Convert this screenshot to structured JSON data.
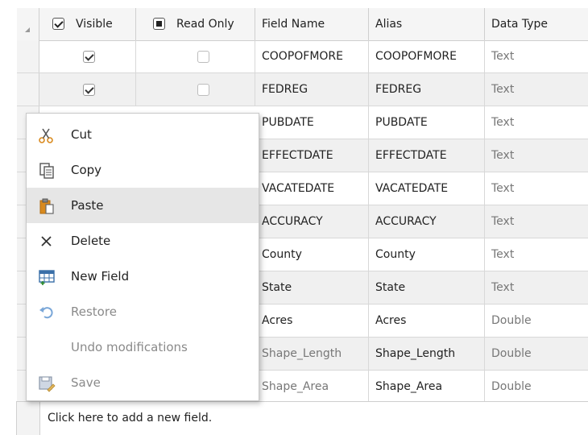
{
  "header": {
    "visible_label": "Visible",
    "read_only_label": "Read Only",
    "field_name_label": "Field Name",
    "alias_label": "Alias",
    "data_type_label": "Data Type"
  },
  "rows": [
    {
      "field_name": "COOPOFMORE",
      "alias": "COOPOFMORE",
      "data_type": "Text",
      "visible": true,
      "read_only": false
    },
    {
      "field_name": "FEDREG",
      "alias": "FEDREG",
      "data_type": "Text",
      "visible": true,
      "read_only": false
    },
    {
      "field_name": "PUBDATE",
      "alias": "PUBDATE",
      "data_type": "Text"
    },
    {
      "field_name": "EFFECTDATE",
      "alias": "EFFECTDATE",
      "data_type": "Text"
    },
    {
      "field_name": "VACATEDATE",
      "alias": "VACATEDATE",
      "data_type": "Text"
    },
    {
      "field_name": "ACCURACY",
      "alias": "ACCURACY",
      "data_type": "Text"
    },
    {
      "field_name": "County",
      "alias": "County",
      "data_type": "Text"
    },
    {
      "field_name": "State",
      "alias": "State",
      "data_type": "Text"
    },
    {
      "field_name": "Acres",
      "alias": "Acres",
      "data_type": "Double"
    },
    {
      "field_name": "Shape_Length",
      "alias": "Shape_Length",
      "data_type": "Double"
    },
    {
      "field_name": "Shape_Area",
      "alias": "Shape_Area",
      "data_type": "Double"
    }
  ],
  "footer": {
    "add_field_text": "Click here to add a new field."
  },
  "context_menu": {
    "cut": "Cut",
    "copy": "Copy",
    "paste": "Paste",
    "delete": "Delete",
    "new_field": "New Field",
    "restore": "Restore",
    "undo": "Undo modifications",
    "save": "Save"
  },
  "icons": {
    "cut": "scissors-icon",
    "copy": "copy-icon",
    "paste": "paste-icon",
    "delete": "delete-x-icon",
    "new_field": "new-field-table-icon",
    "restore": "restore-undo-icon",
    "save": "save-disk-icon"
  },
  "colors": {
    "paste_icon": "#d98a1e",
    "restore_icon": "#7aa7d8",
    "new_field_icon": "#3a6fa8",
    "cut_icon": "#d98a1e"
  }
}
